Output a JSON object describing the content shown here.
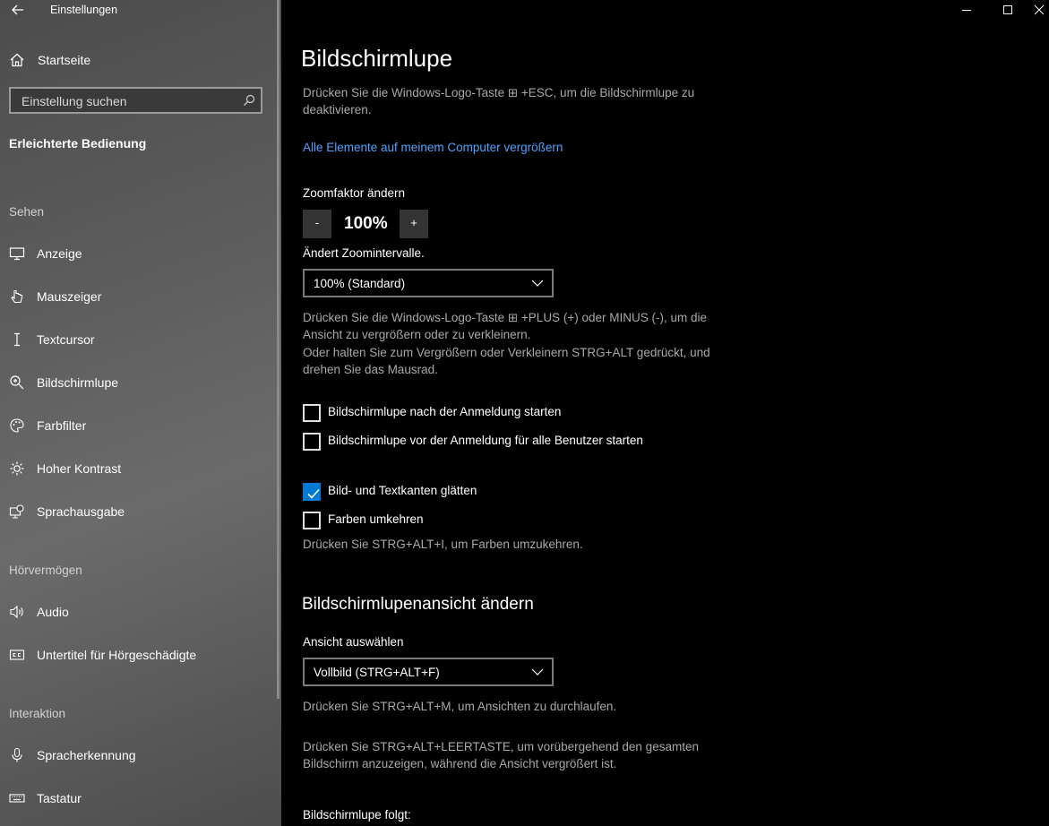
{
  "window": {
    "title": "Einstellungen",
    "back_label": "←"
  },
  "sidebar": {
    "home": "Startseite",
    "search_placeholder": "Einstellung suchen",
    "section": "Erleichterte Bedienung",
    "groups": [
      {
        "header": "Sehen",
        "items": [
          {
            "label": "Anzeige",
            "icon": "monitor-icon"
          },
          {
            "label": "Mauszeiger",
            "icon": "mouse-pointer-icon"
          },
          {
            "label": "Textcursor",
            "icon": "text-cursor-icon"
          },
          {
            "label": "Bildschirmlupe",
            "icon": "magnifier-icon"
          },
          {
            "label": "Farbfilter",
            "icon": "color-filter-icon"
          },
          {
            "label": "Hoher Kontrast",
            "icon": "high-contrast-icon"
          },
          {
            "label": "Sprachausgabe",
            "icon": "narrator-icon"
          }
        ]
      },
      {
        "header": "Hörvermögen",
        "items": [
          {
            "label": "Audio",
            "icon": "speaker-icon"
          },
          {
            "label": "Untertitel für Hörgeschädigte",
            "icon": "closed-caption-icon"
          }
        ]
      },
      {
        "header": "Interaktion",
        "items": [
          {
            "label": "Spracherkennung",
            "icon": "microphone-icon"
          },
          {
            "label": "Tastatur",
            "icon": "keyboard-icon"
          }
        ]
      }
    ]
  },
  "main": {
    "title": "Bildschirmlupe",
    "disable_hint": "Drücken Sie die Windows-Logo-Taste ⊞ +ESC, um die Bildschirmlupe zu deaktivieren.",
    "link": "Alle Elemente auf meinem Computer vergrößern",
    "zoom_label": "Zoomfaktor ändern",
    "zoom_minus": "-",
    "zoom_value": "100%",
    "zoom_plus": "+",
    "interval_label": "Ändert Zoomintervalle.",
    "interval_value": "100% (Standard)",
    "zoom_hint_1": "Drücken Sie die Windows-Logo-Taste ⊞ +PLUS (+) oder MINUS (-), um die Ansicht zu vergrößern oder zu verkleinern.",
    "zoom_hint_2": "Oder halten Sie zum Vergrößern oder Verkleinern STRG+ALT gedrückt, und drehen Sie das Mausrad.",
    "checkboxes": [
      {
        "label": "Bildschirmlupe nach der Anmeldung starten",
        "checked": false
      },
      {
        "label": "Bildschirmlupe vor der Anmeldung für alle Benutzer starten",
        "checked": false
      },
      {
        "label": "Bild- und Textkanten glätten",
        "checked": true
      },
      {
        "label": "Farben umkehren",
        "checked": false
      }
    ],
    "invert_hint": "Drücken Sie STRG+ALT+I, um Farben umzukehren.",
    "view_section": "Bildschirmlupenansicht ändern",
    "view_label": "Ansicht auswählen",
    "view_value": "Vollbild (STRG+ALT+F)",
    "view_hint_1": "Drücken Sie STRG+ALT+M, um Ansichten zu durchlaufen.",
    "view_hint_2": "Drücken Sie STRG+ALT+LEERTASTE, um vorübergehend den gesamten Bildschirm anzuzeigen, während die Ansicht vergrößert ist.",
    "follows_label": "Bildschirmlupe folgt:"
  },
  "colors": {
    "accent": "#0078d4",
    "link": "#4da3ff",
    "hint_text": "#a8a8a8"
  }
}
